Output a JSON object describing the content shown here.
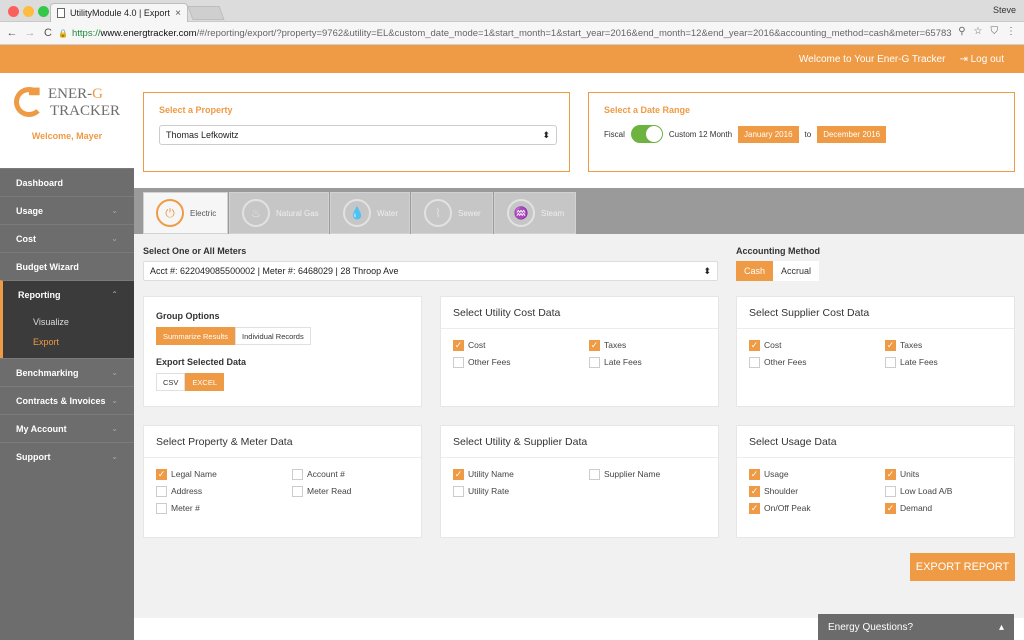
{
  "browser": {
    "tab_title": "UtilityModule 4.0 | Export",
    "tab_close": "×",
    "user": "Steve",
    "back": "←",
    "forward": "→",
    "reload": "C",
    "lock": "🔒",
    "url_https": "https://",
    "url_host": "www.energtracker.com",
    "url_path": "/#/reporting/export/?property=9762&utility=EL&custom_date_mode=1&start_month=1&start_year=2016&end_month=12&end_year=2016&accounting_method=cash&meter=65783",
    "key_icon": "⚲",
    "star_icon": "☆",
    "ext_icon": "⛉",
    "menu_icon": "⋮"
  },
  "topbar": {
    "welcome": "Welcome to Your Ener-G Tracker",
    "logout_icon": "⇥",
    "logout": "Log out"
  },
  "brand": {
    "line1": "ENER-",
    "line1b": "G",
    "line2": "TRACKER",
    "welcome": "Welcome, Mayer",
    "bars": "▮▮▮"
  },
  "nav": {
    "chev_down": "⌄",
    "chev_up": "⌃",
    "items": [
      {
        "label": "Dashboard"
      },
      {
        "label": "Usage"
      },
      {
        "label": "Cost"
      },
      {
        "label": "Budget Wizard"
      },
      {
        "label": "Reporting"
      },
      {
        "label": "Benchmarking"
      },
      {
        "label": "Contracts & Invoices"
      },
      {
        "label": "My Account"
      },
      {
        "label": "Support"
      }
    ],
    "sub": [
      "Visualize",
      "Export"
    ]
  },
  "property": {
    "title": "Select a Property",
    "value": "Thomas Lefkowitz",
    "arrow": "⬍"
  },
  "date": {
    "title": "Select a Date Range",
    "fiscal": "Fiscal",
    "custom": "Custom 12 Month",
    "start": "January 2016",
    "to": "to",
    "end": "December 2016"
  },
  "utilities": [
    {
      "label": "Electric",
      "icon": "⏻"
    },
    {
      "label": "Natural Gas",
      "icon": "♨"
    },
    {
      "label": "Water",
      "icon": "💧"
    },
    {
      "label": "Sewer",
      "icon": "⌇"
    },
    {
      "label": "Steam",
      "icon": "♒"
    }
  ],
  "meter": {
    "label": "Select One or All Meters",
    "value": "Acct #: 622049085500002 | Meter #: 6468029 | 28 Throop Ave",
    "arrow": "⬍"
  },
  "accounting": {
    "label": "Accounting Method",
    "options": [
      "Cash",
      "Accrual"
    ]
  },
  "group": {
    "title": "Group Options",
    "options": [
      "Summarize Results",
      "Individual Records"
    ],
    "export_title": "Export Selected Data",
    "export_options": [
      "CSV",
      "EXCEL"
    ]
  },
  "check": "✓",
  "cards": {
    "utility_cost": {
      "title": "Select Utility Cost Data",
      "items": [
        {
          "label": "Cost",
          "on": true
        },
        {
          "label": "Taxes",
          "on": true
        },
        {
          "label": "Other Fees",
          "on": false
        },
        {
          "label": "Late Fees",
          "on": false
        }
      ]
    },
    "supplier_cost": {
      "title": "Select Supplier Cost Data",
      "items": [
        {
          "label": "Cost",
          "on": true
        },
        {
          "label": "Taxes",
          "on": true
        },
        {
          "label": "Other Fees",
          "on": false
        },
        {
          "label": "Late Fees",
          "on": false
        }
      ]
    },
    "property_meter": {
      "title": "Select Property & Meter Data",
      "items": [
        {
          "label": "Legal Name",
          "on": true
        },
        {
          "label": "Account #",
          "on": false
        },
        {
          "label": "Address",
          "on": false
        },
        {
          "label": "Meter Read",
          "on": false
        },
        {
          "label": "Meter #",
          "on": false
        }
      ]
    },
    "utility_supplier": {
      "title": "Select Utility & Supplier Data",
      "items": [
        {
          "label": "Utility Name",
          "on": true
        },
        {
          "label": "Supplier Name",
          "on": false
        },
        {
          "label": "Utility Rate",
          "on": false
        }
      ]
    },
    "usage": {
      "title": "Select Usage Data",
      "items": [
        {
          "label": "Usage",
          "on": true
        },
        {
          "label": "Units",
          "on": true
        },
        {
          "label": "Shoulder",
          "on": true
        },
        {
          "label": "Low Load A/B",
          "on": false
        },
        {
          "label": "On/Off Peak",
          "on": true
        },
        {
          "label": "Demand",
          "on": true
        }
      ]
    }
  },
  "export_button": "EXPORT REPORT",
  "energy_questions": {
    "label": "Energy Questions?",
    "arrow": "▴"
  }
}
